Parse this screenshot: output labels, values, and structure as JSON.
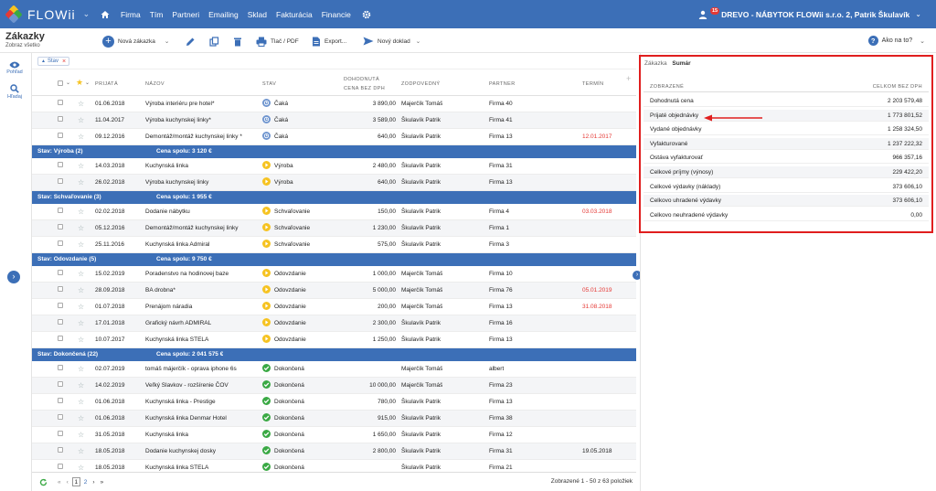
{
  "app": {
    "name": "FLOWii",
    "logo_colors": [
      "#f6c321",
      "#e53935",
      "#3aa944",
      "#6f95cf"
    ]
  },
  "nav": {
    "items": [
      "Firma",
      "Tím",
      "Partneri",
      "Emailing",
      "Sklad",
      "Fakturácia",
      "Financie"
    ]
  },
  "user": {
    "notifications": "15",
    "label": "DREVO - NÁBYTOK FLOWii s.r.o. 2, Patrik Škulavík"
  },
  "page": {
    "title": "Zákazky",
    "subtitle": "Zobraz všetko"
  },
  "toolbar": {
    "new_label": "Nová zákazka",
    "print_label": "Tlač / PDF",
    "export_label": "Export...",
    "new_doc_label": "Nový doklad",
    "help_label": "Ako na to?"
  },
  "rail": {
    "view_label": "Pohľad",
    "search_label": "Hľadaj"
  },
  "filter": {
    "chip_label": "Stav"
  },
  "columns": {
    "prijata": "PRIJATÁ",
    "nazov": "NÁZOV",
    "stav": "STAV",
    "cena_1": "DOHODNUTÁ",
    "cena_2": "CENA BEZ DPH",
    "zodpovedny": "ZODPOVEDNÝ",
    "partner": "PARTNER",
    "termin": "TERMÍN"
  },
  "rows": [
    {
      "type": "row",
      "date": "01.06.2018",
      "name": "Výroba interiéru pre hotel*",
      "status": "Čaká",
      "status_kind": "wait",
      "price": "3 890,00",
      "owner": "Majerčík Tomáš",
      "partner": "Firma 40",
      "term": "",
      "term_red": false
    },
    {
      "type": "row",
      "date": "11.04.2017",
      "name": "Výroba kuchynskej linky*",
      "status": "Čaká",
      "status_kind": "wait",
      "price": "3 589,00",
      "owner": "Škulavík Patrik",
      "partner": "Firma 41",
      "term": "",
      "term_red": false
    },
    {
      "type": "row",
      "date": "09.12.2016",
      "name": "Demontáž/montáž kuchynskej linky *",
      "status": "Čaká",
      "status_kind": "wait",
      "price": "640,00",
      "owner": "Škulavík Patrik",
      "partner": "Firma 13",
      "term": "12.01.2017",
      "term_red": true
    },
    {
      "type": "group",
      "label": "Stav: Výroba (2)",
      "sum": "Cena spolu: 3 120 €"
    },
    {
      "type": "row",
      "date": "14.03.2018",
      "name": "Kuchynská linka",
      "status": "Výroba",
      "status_kind": "prod",
      "price": "2 480,00",
      "owner": "Škulavík Patrik",
      "partner": "Firma 31",
      "term": "",
      "term_red": false
    },
    {
      "type": "row",
      "date": "26.02.2018",
      "name": "Výroba kuchynskej linky",
      "status": "Výroba",
      "status_kind": "prod",
      "price": "640,00",
      "owner": "Škulavík Patrik",
      "partner": "Firma 13",
      "term": "",
      "term_red": false
    },
    {
      "type": "group",
      "label": "Stav: Schvaľovanie (3)",
      "sum": "Cena spolu: 1 955 €"
    },
    {
      "type": "row",
      "date": "02.02.2018",
      "name": "Dodanie nábytku",
      "status": "Schvaľovanie",
      "status_kind": "prod",
      "price": "150,00",
      "owner": "Škulavík Patrik",
      "partner": "Firma 4",
      "term": "03.03.2018",
      "term_red": true
    },
    {
      "type": "row",
      "date": "05.12.2016",
      "name": "Demontáž/montáž kuchynskej linky",
      "status": "Schvaľovanie",
      "status_kind": "prod",
      "price": "1 230,00",
      "owner": "Škulavík Patrik",
      "partner": "Firma 1",
      "term": "",
      "term_red": false
    },
    {
      "type": "row",
      "date": "25.11.2016",
      "name": "Kuchynská linka Admiral",
      "status": "Schvaľovanie",
      "status_kind": "prod",
      "price": "575,00",
      "owner": "Škulavík Patrik",
      "partner": "Firma 3",
      "term": "",
      "term_red": false
    },
    {
      "type": "group",
      "label": "Stav: Odovzdanie (5)",
      "sum": "Cena spolu: 9 750 €"
    },
    {
      "type": "row",
      "date": "15.02.2019",
      "name": "Poradenstvo na hodinovej baze",
      "status": "Odovzdanie",
      "status_kind": "prod",
      "price": "1 000,00",
      "owner": "Majerčík Tomáš",
      "partner": "Firma 10",
      "term": "",
      "term_red": false
    },
    {
      "type": "row",
      "date": "28.09.2018",
      "name": "BA drobna*",
      "status": "Odovzdanie",
      "status_kind": "prod",
      "price": "5 000,00",
      "owner": "Majerčík Tomáš",
      "partner": "Firma 76",
      "term": "05.01.2019",
      "term_red": true
    },
    {
      "type": "row",
      "date": "01.07.2018",
      "name": "Prenájom náradia",
      "status": "Odovzdanie",
      "status_kind": "prod",
      "price": "200,00",
      "owner": "Majerčík Tomáš",
      "partner": "Firma 13",
      "term": "31.08.2018",
      "term_red": true
    },
    {
      "type": "row",
      "date": "17.01.2018",
      "name": "Grafický návrh ADMIRAL",
      "status": "Odovzdanie",
      "status_kind": "prod",
      "price": "2 300,00",
      "owner": "Škulavík Patrik",
      "partner": "Firma 16",
      "term": "",
      "term_red": false
    },
    {
      "type": "row",
      "date": "10.07.2017",
      "name": "Kuchynská linka STELA",
      "status": "Odovzdanie",
      "status_kind": "prod",
      "price": "1 250,00",
      "owner": "Škulavík Patrik",
      "partner": "Firma 13",
      "term": "",
      "term_red": false
    },
    {
      "type": "group",
      "label": "Stav: Dokončená (22)",
      "sum": "Cena spolu: 2 041 575 €"
    },
    {
      "type": "row",
      "date": "02.07.2019",
      "name": "tomáš májerčík - oprava iphone 6s",
      "status": "Dokončená",
      "status_kind": "ok",
      "price": "",
      "owner": "Majerčík Tomáš",
      "partner": "albert",
      "term": "",
      "term_red": false
    },
    {
      "type": "row",
      "date": "14.02.2019",
      "name": "Veľký Slavkov - rozšírenie ČOV",
      "status": "Dokončená",
      "status_kind": "ok",
      "price": "10 000,00",
      "owner": "Majerčík Tomáš",
      "partner": "Firma 23",
      "term": "",
      "term_red": false
    },
    {
      "type": "row",
      "date": "01.06.2018",
      "name": "Kuchynská linka - Prestige",
      "status": "Dokončená",
      "status_kind": "ok",
      "price": "780,00",
      "owner": "Škulavík Patrik",
      "partner": "Firma 13",
      "term": "",
      "term_red": false
    },
    {
      "type": "row",
      "date": "01.06.2018",
      "name": "Kuchynská linka Denmar Hotel",
      "status": "Dokončená",
      "status_kind": "ok",
      "price": "915,00",
      "owner": "Škulavík Patrik",
      "partner": "Firma 38",
      "term": "",
      "term_red": false
    },
    {
      "type": "row",
      "date": "31.05.2018",
      "name": "Kuchynská linka",
      "status": "Dokončená",
      "status_kind": "ok",
      "price": "1 650,00",
      "owner": "Škulavík Patrik",
      "partner": "Firma 12",
      "term": "",
      "term_red": false
    },
    {
      "type": "row",
      "date": "18.05.2018",
      "name": "Dodanie kuchynskej dosky",
      "status": "Dokončená",
      "status_kind": "ok",
      "price": "2 800,00",
      "owner": "Škulavík Patrik",
      "partner": "Firma 31",
      "term": "19.05.2018",
      "term_red": false
    },
    {
      "type": "row",
      "date": "18.05.2018",
      "name": "Kuchynská linka STELA",
      "status": "Dokončená",
      "status_kind": "ok",
      "price": "",
      "owner": "Škulavík Patrik",
      "partner": "Firma 21",
      "term": "",
      "term_red": false
    }
  ],
  "pager": {
    "first": "«",
    "prev": "‹",
    "page1": "1",
    "page2": "2",
    "next": "›",
    "last": "»",
    "count": "Zobrazené 1 - 50 z 63 položiek"
  },
  "summary": {
    "tab_1": "Zákazka",
    "tab_2": "Sumár",
    "col_label": "ZOBRAZENÉ",
    "col_value": "CELKOM BEZ DPH",
    "rows": [
      {
        "label": "Dohodnutá cena",
        "value": "2 203 579,48"
      },
      {
        "label": "Prijaté objednávky",
        "value": "1 773 801,52"
      },
      {
        "label": "Vydané objednávky",
        "value": "1 258 324,50"
      },
      {
        "label": "Vyfakturované",
        "value": "1 237 222,32"
      },
      {
        "label": "Ostáva vyfakturovať",
        "value": "966 357,16"
      },
      {
        "label": "Celkové príjmy (výnosy)",
        "value": "229 422,20"
      },
      {
        "label": "Celkové výdavky (náklady)",
        "value": "373 606,10"
      },
      {
        "label": "Celkovo uhradené výdavky",
        "value": "373 606,10"
      },
      {
        "label": "Celkovo neuhradené výdavky",
        "value": "0,00"
      }
    ]
  },
  "colors": {
    "brand": "#3c6fb7",
    "highlight": "#e01e1e",
    "overdue": "#e53935"
  }
}
